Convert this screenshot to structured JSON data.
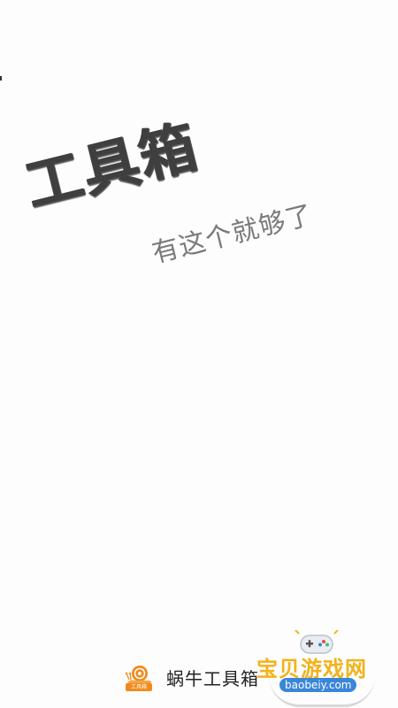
{
  "splash": {
    "title": "工具箱",
    "subtitle": "有这个就够了"
  },
  "brand": {
    "logo_icon": "snail-logo-icon",
    "logo_caption": "工具箱",
    "name": "蜗牛工具箱"
  },
  "watermark": {
    "icon": "game-controller-icon",
    "text": "宝贝游戏网",
    "url": "baobeiy.com"
  },
  "colors": {
    "title": "#3f3f3f",
    "subtitle": "#7a7a7a",
    "logo_orange": "#f08a1c",
    "watermark_yellow": "#f3b21b",
    "watermark_blue": "#3a86d8"
  }
}
